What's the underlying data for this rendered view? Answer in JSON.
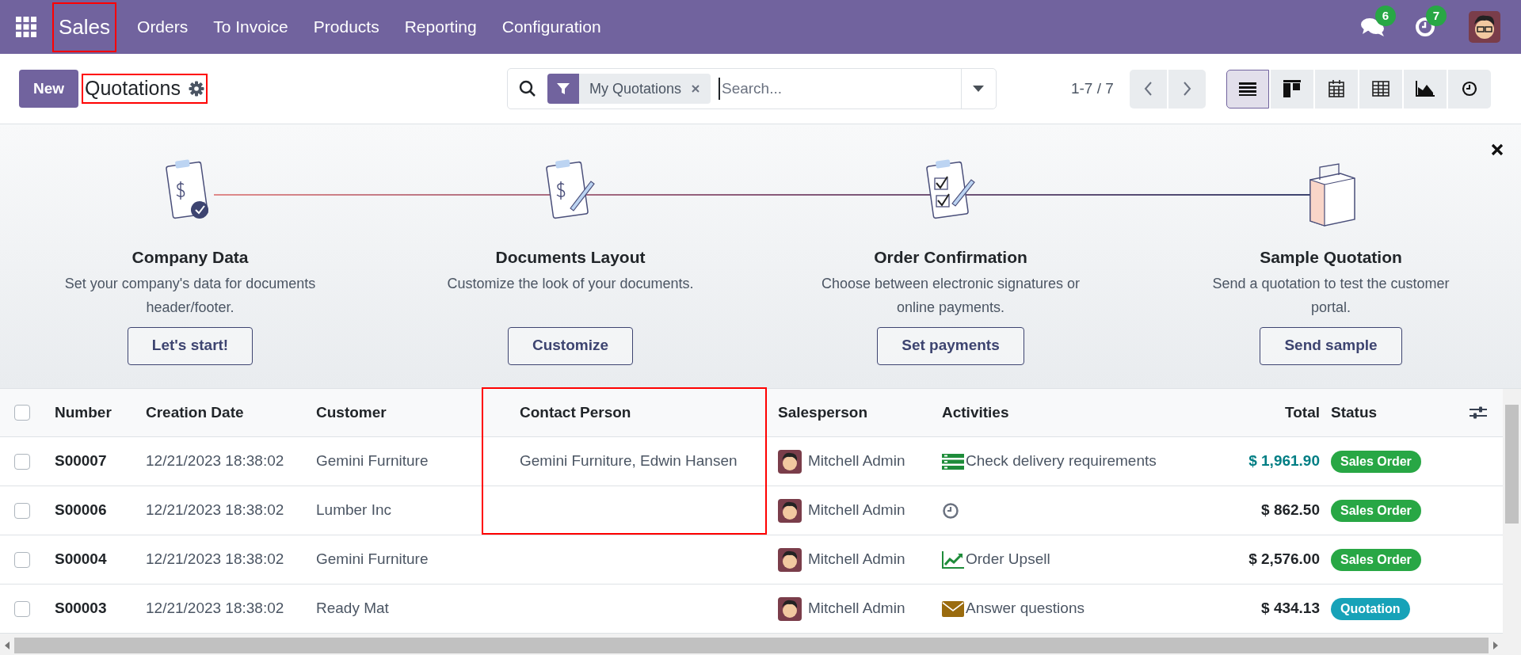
{
  "navbar": {
    "menu": [
      {
        "label": "Sales",
        "kind": "brand",
        "highlighted": true
      },
      {
        "label": "Orders",
        "kind": "item",
        "highlighted": false
      },
      {
        "label": "To Invoice",
        "kind": "item",
        "highlighted": false
      },
      {
        "label": "Products",
        "kind": "item",
        "highlighted": false
      },
      {
        "label": "Reporting",
        "kind": "item",
        "highlighted": false
      },
      {
        "label": "Configuration",
        "kind": "item",
        "highlighted": false
      }
    ],
    "messages_count": "6",
    "activities_count": "7"
  },
  "control_panel": {
    "new_button": "New",
    "title": "Quotations",
    "title_highlighted": true,
    "search": {
      "facet": "My Quotations",
      "placeholder": "Search..."
    },
    "pager": "1-7 / 7",
    "views": [
      {
        "kind": "list",
        "selected": true
      },
      {
        "kind": "kanban",
        "selected": false
      },
      {
        "kind": "calendar",
        "selected": false
      },
      {
        "kind": "pivot",
        "selected": false
      },
      {
        "kind": "graph",
        "selected": false
      },
      {
        "kind": "activity",
        "selected": false
      }
    ]
  },
  "onboarding": {
    "steps": [
      {
        "kind": "company",
        "title": "Company Data",
        "description": "Set your company's data for documents header/footer.",
        "button": "Let's start!"
      },
      {
        "kind": "layout",
        "title": "Documents Layout",
        "description": "Customize the look of your documents.",
        "button": "Customize"
      },
      {
        "kind": "confirmation",
        "title": "Order Confirmation",
        "description": "Choose between electronic signatures or online payments.",
        "button": "Set payments"
      },
      {
        "kind": "sample",
        "title": "Sample Quotation",
        "description": "Send a quotation to test the customer portal.",
        "button": "Send sample"
      }
    ]
  },
  "table": {
    "all_checked": false,
    "columns": [
      {
        "label": "Number",
        "highlighted": false
      },
      {
        "label": "Creation Date",
        "highlighted": false
      },
      {
        "label": "Customer",
        "highlighted": false
      },
      {
        "label": "Contact Person",
        "highlighted": true
      },
      {
        "label": "Salesperson",
        "highlighted": false
      },
      {
        "label": "Activities",
        "highlighted": false
      },
      {
        "label": "Total",
        "highlighted": false
      },
      {
        "label": "Status",
        "highlighted": false
      }
    ],
    "rows": [
      {
        "checked": false,
        "number": "S00007",
        "date": "12/21/2023 18:38:02",
        "customer": "Gemini Furniture",
        "contact": "Gemini Furniture, Edwin Hansen",
        "salesperson": "Mitchell Admin",
        "activity": {
          "kind": "todo",
          "label": "Check delivery requirements"
        },
        "total": "$ 1,961.90",
        "total_link": true,
        "status": {
          "kind": "order",
          "label": "Sales Order"
        }
      },
      {
        "checked": false,
        "number": "S00006",
        "date": "12/21/2023 18:38:02",
        "customer": "Lumber Inc",
        "salesperson": "Mitchell Admin",
        "activity": {
          "kind": "clock"
        },
        "total": "$ 862.50",
        "total_link": false,
        "status": {
          "kind": "order",
          "label": "Sales Order"
        }
      },
      {
        "checked": false,
        "number": "S00004",
        "date": "12/21/2023 18:38:02",
        "customer": "Gemini Furniture",
        "salesperson": "Mitchell Admin",
        "activity": {
          "kind": "upsell",
          "label": "Order Upsell"
        },
        "total": "$ 2,576.00",
        "total_link": false,
        "status": {
          "kind": "order",
          "label": "Sales Order"
        }
      },
      {
        "checked": false,
        "number": "S00003",
        "date": "12/21/2023 18:38:02",
        "customer": "Ready Mat",
        "salesperson": "Mitchell Admin",
        "activity": {
          "kind": "email",
          "label": "Answer questions"
        },
        "total": "$ 434.13",
        "total_link": false,
        "status": {
          "kind": "quotation",
          "label": "Quotation"
        }
      }
    ]
  }
}
